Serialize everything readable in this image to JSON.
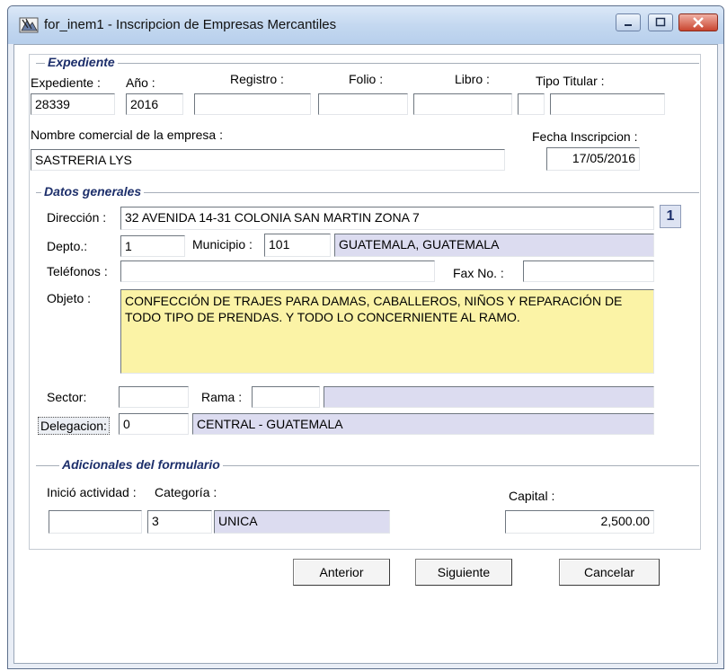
{
  "window": {
    "title": "for_inem1 - Inscripcion de Empresas Mercantiles"
  },
  "expediente": {
    "section": "Expediente",
    "expediente_label": "Expediente :",
    "expediente_value": "28339",
    "anio_label": "Año :",
    "anio_value": "2016",
    "registro_label": "Registro :",
    "registro_value": "",
    "folio_label": "Folio :",
    "folio_value": "",
    "libro_label": "Libro :",
    "libro_value": "",
    "tipo_titular_label": "Tipo Titular :",
    "tipo_titular_value1": "",
    "tipo_titular_value2": "",
    "nombre_label": "Nombre comercial de la empresa :",
    "nombre_value": "SASTRERIA LYS",
    "fecha_label": "Fecha  Inscripcion :",
    "fecha_value": "17/05/2016"
  },
  "datos": {
    "section": "Datos generales",
    "direccion_label": "Dirección :",
    "direccion_value": "32  AVENIDA  14-31  COLONIA  SAN  MARTIN ZONA 7",
    "page_badge": "1",
    "depto_label": "Depto.:",
    "depto_value": "1",
    "municipio_label": "Municipio :",
    "municipio_code": "101",
    "municipio_name": "GUATEMALA, GUATEMALA",
    "telefonos_label": "Teléfonos :",
    "telefonos_value": "",
    "fax_label": "Fax No. :",
    "fax_value": "",
    "objeto_label": "Objeto :",
    "objeto_value": "CONFECCIÓN DE TRAJES PARA DAMAS, CABALLEROS, NIÑOS Y REPARACIÓN DE TODO TIPO DE PRENDAS. Y TODO LO CONCERNIENTE AL RAMO.",
    "sector_label": "Sector:",
    "sector_value": "",
    "rama_label": "Rama :",
    "rama_code": "",
    "rama_name": "",
    "delegacion_label": "Delegacion:",
    "delegacion_code": "0",
    "delegacion_name": "CENTRAL - GUATEMALA"
  },
  "adicionales": {
    "section": "Adicionales del formulario",
    "inicio_label": "Inició actividad :",
    "inicio_value": "",
    "categoria_label": "Categoría :",
    "categoria_code": "3",
    "categoria_name": "UNICA",
    "capital_label": "Capital :",
    "capital_value": "2,500.00"
  },
  "buttons": {
    "anterior": "Anterior",
    "siguiente": "Siguiente",
    "cancelar": "Cancelar"
  }
}
